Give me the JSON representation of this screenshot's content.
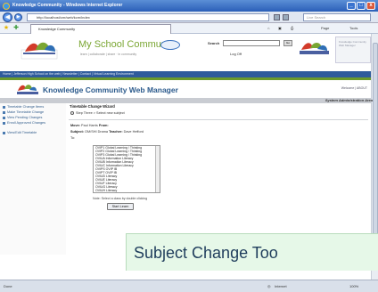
{
  "window": {
    "title": "Knowledge Community - Windows Internet Explorer",
    "controls": [
      "_",
      "□",
      "x"
    ]
  },
  "address_bar": {
    "url": "http://localhost/cm/web/kcm/index",
    "search_placeholder": "Live Search"
  },
  "tabs": [
    {
      "label": "Knowledge Community"
    }
  ],
  "toolbar": {
    "page_label": "Page",
    "tools_label": "Tools"
  },
  "header": {
    "brand": "My School Community",
    "brand_sub": "learn | collaborate | share · in community",
    "search_label": "Search",
    "go_label": "Go",
    "logoff_label": "Log Off",
    "admin_box_text": "Knowledge Community Web Manager"
  },
  "nav": {
    "text": "Home | Jefferson High School on the web | Newsletter | Contact | Virtual Learning Environment"
  },
  "kcm": {
    "title": "Knowledge Community Web Manager",
    "welcome": "Welcome | ABOUT",
    "section": "System Administration Area"
  },
  "sidebar": {
    "items": [
      {
        "label": "Timetable Change Items"
      },
      {
        "label": "Make Timetable Change"
      },
      {
        "label": "View Pending Changes"
      },
      {
        "label": "Enroll Approved Changes"
      },
      {
        "label": "View/Edit Timetable"
      }
    ]
  },
  "main": {
    "heading": "Timetable Change Wizard",
    "radio_label": "Step Three > Select new subject",
    "move_label": "Move:",
    "move_value": "Paul Harris",
    "from_label": "From:",
    "subject_label": "Subject:",
    "subject_value": "OM/SHI Drama",
    "teacher_label": "Teacher:",
    "teacher_value": "Dave Hefford",
    "to_label": "To:",
    "options": [
      "OVIP1 Global Learning / Thinking",
      "OVIP2 Global Learning / Thinking",
      "OVIP3 Global Learning / Thinking",
      "OVIUA Information Literacy",
      "OVIUB Information Literacy",
      "OVIUC Information Literacy",
      "OVIPS OVIP IB",
      "OVIPT OVIP IB",
      "OVIUD Literacy",
      "OVIUE Literacy",
      "OVIUF Literacy",
      "OVIUG Literacy",
      "OVIUH Literacy"
    ],
    "hint": "Note: Select a class by double clicking",
    "start_again": "Start Learn"
  },
  "status": {
    "left": "Done",
    "zone": "Internet",
    "zoom": "100%"
  },
  "caption": {
    "text": "Subject Change Too"
  }
}
